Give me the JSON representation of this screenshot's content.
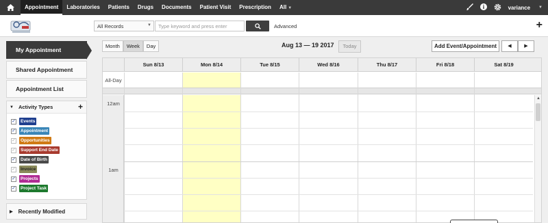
{
  "nav": {
    "items": [
      "Appointment",
      "Laboratories",
      "Patients",
      "Drugs",
      "Documents",
      "Patient Visit",
      "Prescription",
      "All"
    ],
    "user": "variance"
  },
  "toolbar": {
    "records_value": "All Records",
    "search_placeholder": "Type keyword and press enter",
    "advanced_label": "Advanced"
  },
  "sidebar": {
    "buttons": [
      "My Appointment",
      "Shared Appointment",
      "Appointment List"
    ],
    "activity_title": "Activity Types",
    "activity_types": [
      {
        "label": "Events",
        "color": "#1f3f8f",
        "checked": true
      },
      {
        "label": "Appointment",
        "color": "#3a86b8",
        "checked": true
      },
      {
        "label": "Opportunities",
        "color": "#d07a14",
        "checked": false
      },
      {
        "label": "Support End Date",
        "color": "#a83a2e",
        "checked": false
      },
      {
        "label": "Date of Birth",
        "color": "#4a4a4a",
        "checked": true
      },
      {
        "label": "Invoice",
        "color": "#8a8a5a",
        "checked": false
      },
      {
        "label": "Projects",
        "color": "#b02c94",
        "checked": true
      },
      {
        "label": "Project Task",
        "color": "#1e7a2e",
        "checked": true
      }
    ],
    "recent_label": "Recently Modified"
  },
  "calendar": {
    "views": [
      "Month",
      "Week",
      "Day"
    ],
    "active_view": "Week",
    "range": "Aug 13 — 19 2017",
    "today_label": "Today",
    "add_label": "Add Event/Appointment",
    "prev_label": "◀",
    "next_label": "▶",
    "days": [
      "Sun 8/13",
      "Mon 8/14",
      "Tue 8/15",
      "Wed 8/16",
      "Thu 8/17",
      "Fri 8/18",
      "Sat 8/19"
    ],
    "today_index": 1,
    "allday_label": "All-Day",
    "time_labels": [
      "12am",
      "1am"
    ]
  },
  "colors": {
    "nav_bg": "#3a3a3a",
    "today_highlight": "#ffffc4"
  }
}
